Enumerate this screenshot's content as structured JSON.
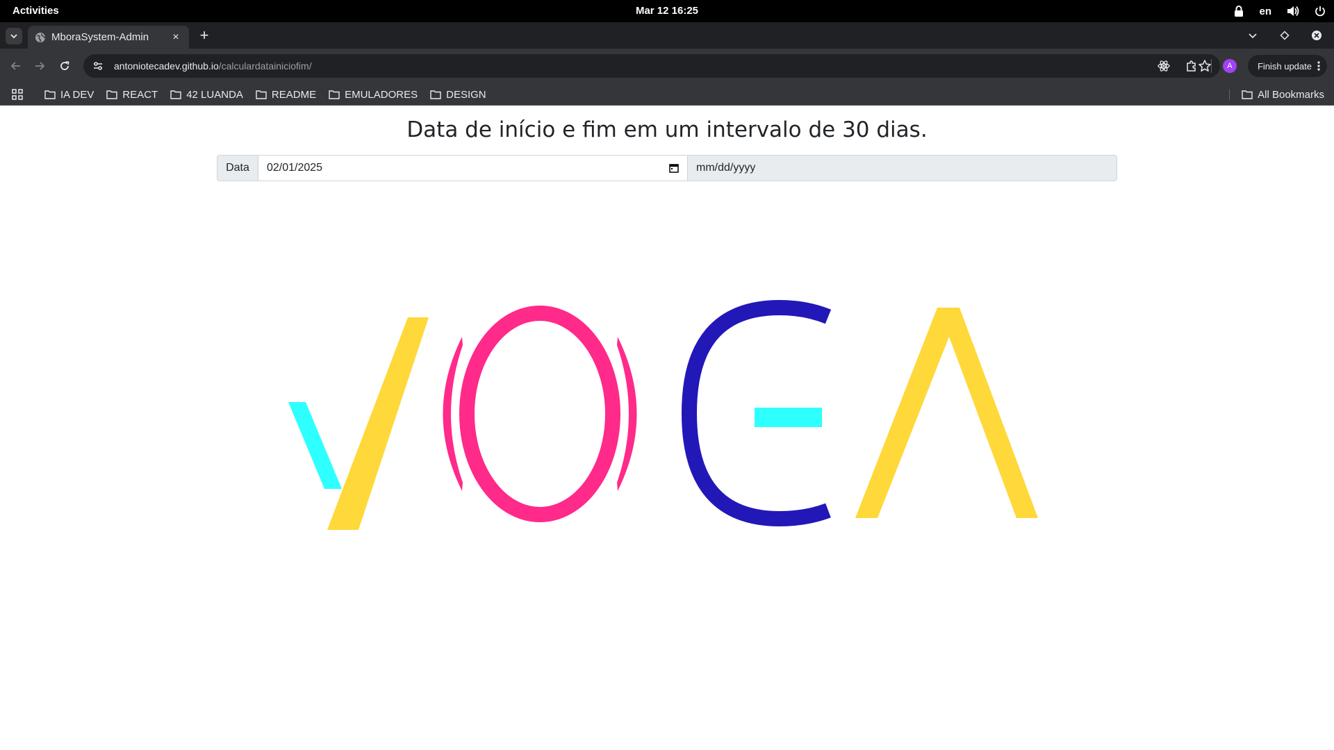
{
  "system": {
    "activities": "Activities",
    "clock": "Mar 12  16:25",
    "language": "en"
  },
  "browser": {
    "tab_title": "MboraSystem-Admin",
    "tab_close": "×",
    "new_tab": "+",
    "url_host": "antoniotecadev.github.io",
    "url_path": "/calculardatainiciofim/",
    "finish_update": "Finish update",
    "avatar_letter": "A"
  },
  "bookmarks": {
    "items": [
      "IA DEV",
      "REACT",
      "42 LUANDA",
      "README",
      "EMULADORES",
      "DESIGN"
    ],
    "all": "All Bookmarks"
  },
  "page": {
    "title": "Data de início e fim em um intervalo de 30 dias.",
    "label": "Data",
    "start_date": "02/01/2025",
    "end_date_placeholder": "mm/dd/yyyy"
  },
  "logo": {
    "text": "YOGA",
    "colors": {
      "cyan": "#2effff",
      "yellow": "#ffd83a",
      "pink": "#ff2a8a",
      "blue": "#2218b8"
    }
  }
}
